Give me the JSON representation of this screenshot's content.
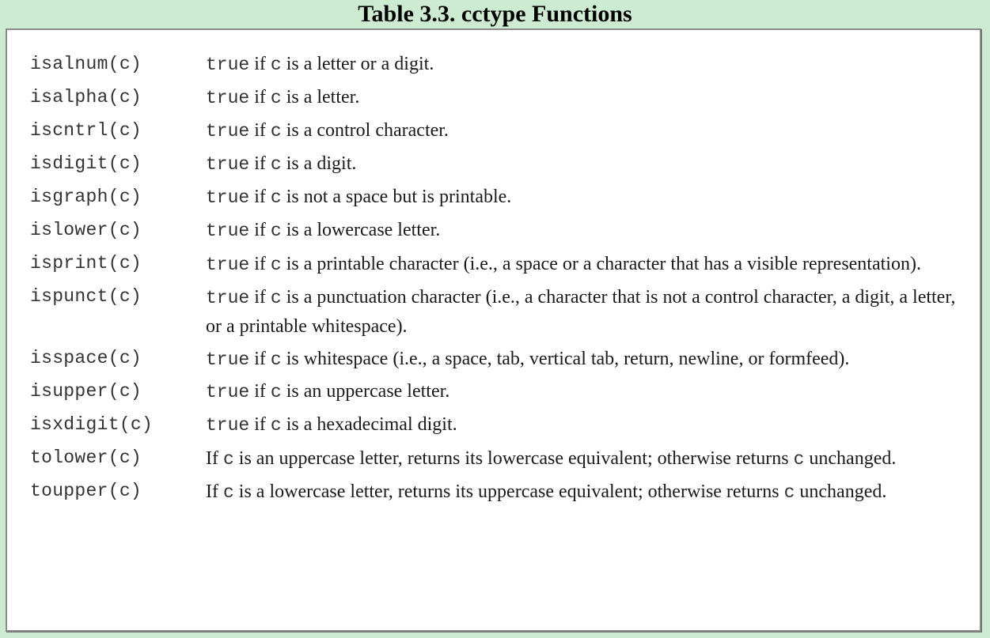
{
  "title": "Table 3.3. cctype Functions",
  "rows": [
    {
      "fn": "isalnum(c)",
      "desc": [
        {
          "code": "true"
        },
        {
          "text": " if "
        },
        {
          "code": "c"
        },
        {
          "text": " is a letter or a digit."
        }
      ]
    },
    {
      "fn": "isalpha(c)",
      "desc": [
        {
          "code": "true"
        },
        {
          "text": " if "
        },
        {
          "code": "c"
        },
        {
          "text": " is a letter."
        }
      ]
    },
    {
      "fn": "iscntrl(c)",
      "desc": [
        {
          "code": "true"
        },
        {
          "text": " if "
        },
        {
          "code": "c"
        },
        {
          "text": " is a control character."
        }
      ]
    },
    {
      "fn": "isdigit(c)",
      "desc": [
        {
          "code": "true"
        },
        {
          "text": " if "
        },
        {
          "code": "c"
        },
        {
          "text": " is a digit."
        }
      ]
    },
    {
      "fn": "isgraph(c)",
      "desc": [
        {
          "code": "true"
        },
        {
          "text": " if "
        },
        {
          "code": "c"
        },
        {
          "text": " is not a space but is printable."
        }
      ]
    },
    {
      "fn": "islower(c)",
      "desc": [
        {
          "code": "true"
        },
        {
          "text": " if "
        },
        {
          "code": "c"
        },
        {
          "text": " is a lowercase letter."
        }
      ]
    },
    {
      "fn": "isprint(c)",
      "desc": [
        {
          "code": "true"
        },
        {
          "text": " if "
        },
        {
          "code": "c"
        },
        {
          "text": " is a printable character (i.e., a space or a character that has a visible representation)."
        }
      ]
    },
    {
      "fn": "ispunct(c)",
      "desc": [
        {
          "code": "true"
        },
        {
          "text": " if "
        },
        {
          "code": "c"
        },
        {
          "text": " is a punctuation character (i.e., a character that is not a control character, a digit, a letter, or a printable whitespace)."
        }
      ]
    },
    {
      "fn": "isspace(c)",
      "desc": [
        {
          "code": "true"
        },
        {
          "text": " if "
        },
        {
          "code": "c"
        },
        {
          "text": " is whitespace (i.e., a space, tab, vertical tab, return, newline, or formfeed)."
        }
      ]
    },
    {
      "fn": "isupper(c)",
      "desc": [
        {
          "code": "true"
        },
        {
          "text": " if "
        },
        {
          "code": "c"
        },
        {
          "text": " is an uppercase letter."
        }
      ]
    },
    {
      "fn": "isxdigit(c)",
      "desc": [
        {
          "code": "true"
        },
        {
          "text": " if "
        },
        {
          "code": "c"
        },
        {
          "text": " is a hexadecimal digit."
        }
      ]
    },
    {
      "fn": "tolower(c)",
      "desc": [
        {
          "text": "If "
        },
        {
          "code": "c"
        },
        {
          "text": " is an uppercase letter, returns its lowercase equivalent; otherwise returns "
        },
        {
          "code": "c"
        },
        {
          "text": " unchanged."
        }
      ]
    },
    {
      "fn": "toupper(c)",
      "desc": [
        {
          "text": "If "
        },
        {
          "code": "c"
        },
        {
          "text": " is a lowercase letter, returns its uppercase equivalent; otherwise returns "
        },
        {
          "code": "c"
        },
        {
          "text": " unchanged."
        }
      ]
    }
  ]
}
